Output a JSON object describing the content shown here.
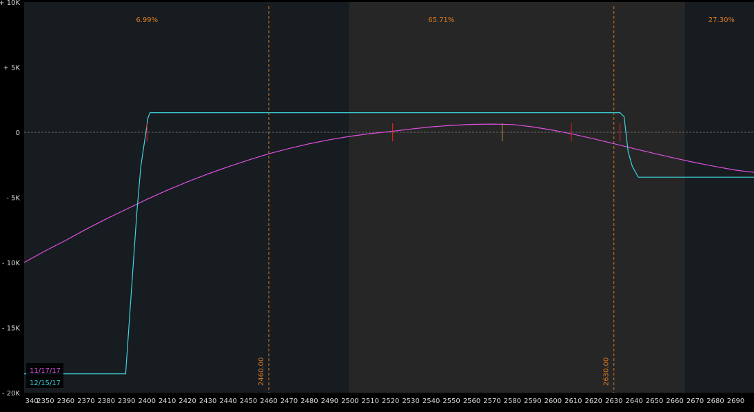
{
  "chart_data": {
    "type": "line",
    "xlim": [
      2339.5,
      2699
    ],
    "ylim": [
      -20000,
      10000
    ],
    "x_ticks": [
      2340,
      2350,
      2360,
      2370,
      2380,
      2390,
      2400,
      2410,
      2420,
      2430,
      2440,
      2450,
      2460,
      2470,
      2480,
      2490,
      2500,
      2510,
      2520,
      2530,
      2540,
      2550,
      2560,
      2570,
      2580,
      2590,
      2600,
      2610,
      2620,
      2630,
      2640,
      2650,
      2660,
      2670,
      2680,
      2690,
      2700
    ],
    "x_tick_labels": [
      "340",
      "2350",
      "2360",
      "2370",
      "2380",
      "2390",
      "2400",
      "2410",
      "2420",
      "2430",
      "2440",
      "2450",
      "2460",
      "2470",
      "2480",
      "2490",
      "2500",
      "2510",
      "2520",
      "2530",
      "2540",
      "2550",
      "2560",
      "2570",
      "2580",
      "2590",
      "2600",
      "2610",
      "2620",
      "2630",
      "2640",
      "2650",
      "2660",
      "2670",
      "2680",
      "2690",
      "2"
    ],
    "y_ticks": [
      10000,
      5000,
      0,
      -5000,
      -10000,
      -15000,
      -20000
    ],
    "y_tick_labels": [
      "+ 10K",
      "+ 5K",
      "0",
      "- 5K",
      "- 10K",
      "- 15K",
      "- 20K"
    ],
    "zero_line": 0,
    "vertical_lines": [
      {
        "x": 2460,
        "label": "2460.00"
      },
      {
        "x": 2630,
        "label": "2630.00"
      }
    ],
    "shaded_band": {
      "x_start": 2499.5,
      "x_end": 2665
    },
    "probabilities": [
      {
        "x": 2400,
        "text": "6.99%"
      },
      {
        "x": 2545,
        "text": "65.71%"
      },
      {
        "x": 2683,
        "text": "27.30%"
      }
    ],
    "series": [
      {
        "name": "11/17/17",
        "color": "#e050e0",
        "x": [
          2339.5,
          2350,
          2360,
          2370,
          2380,
          2390,
          2400,
          2410,
          2420,
          2430,
          2440,
          2450,
          2460,
          2470,
          2480,
          2490,
          2500,
          2510,
          2520,
          2530,
          2540,
          2550,
          2560,
          2570,
          2580,
          2590,
          2600,
          2610,
          2620,
          2630,
          2640,
          2650,
          2660,
          2670,
          2680,
          2690,
          2699
        ],
        "y": [
          -10000,
          -9100,
          -8300,
          -7450,
          -6650,
          -5900,
          -5150,
          -4450,
          -3800,
          -3200,
          -2650,
          -2130,
          -1650,
          -1250,
          -880,
          -570,
          -310,
          -100,
          60,
          250,
          420,
          530,
          610,
          630,
          600,
          420,
          160,
          -150,
          -500,
          -880,
          -1260,
          -1630,
          -1990,
          -2330,
          -2630,
          -2910,
          -3080
        ]
      },
      {
        "name": "12/15/17",
        "color": "#3fd6e0",
        "x": [
          2339.5,
          2389.5,
          2395,
          2397,
          2399,
          2400.5,
          2401.5,
          2633,
          2635,
          2637,
          2639,
          2642,
          2699
        ],
        "y": [
          -18550,
          -18550,
          -6200,
          -2600,
          -500,
          1100,
          1500,
          1500,
          1200,
          -1500,
          -2600,
          -3450,
          -3450
        ]
      }
    ],
    "markers": [
      {
        "x": 2400,
        "y": 0,
        "color": "#ff2020"
      },
      {
        "x": 2521,
        "y": 0,
        "color": "#ff2020"
      },
      {
        "x": 2609,
        "y": 0,
        "color": "#ff2020"
      },
      {
        "x": 2633,
        "y": 0,
        "color": "#ff2020"
      },
      {
        "x": 2575,
        "y": 0,
        "color": "#c49a3a"
      }
    ],
    "legend": {
      "position": "bottom-left",
      "items": [
        "11/17/17",
        "12/15/17"
      ]
    },
    "grid": false
  }
}
